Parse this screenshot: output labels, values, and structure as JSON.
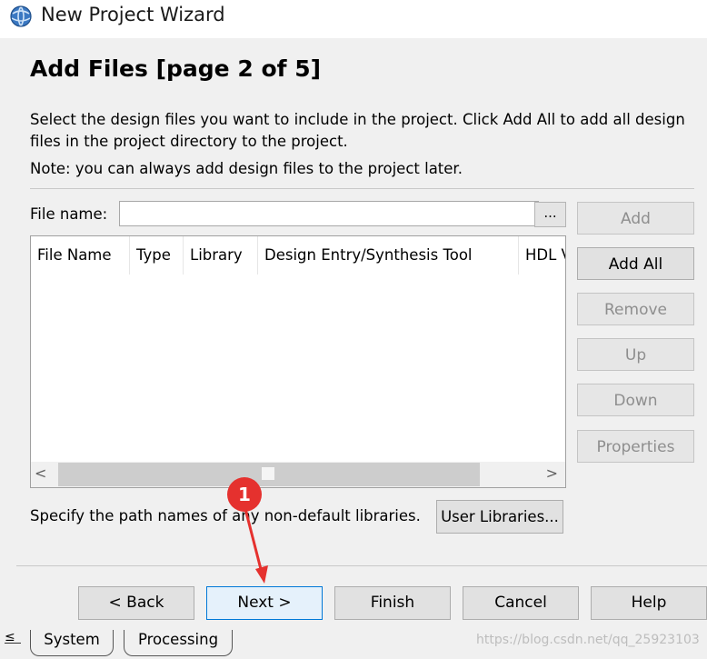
{
  "window": {
    "title": "New Project Wizard",
    "icon": "quartus-globe-icon"
  },
  "page": {
    "title": "Add Files [page 2 of 5]",
    "description": "Select the design files you want to include in the project. Click Add All to add all design files in the project directory to the project.",
    "note": "Note: you can always add design files to the project later."
  },
  "file_name": {
    "label": "File name:",
    "value": "",
    "browse_label": "..."
  },
  "table": {
    "columns": [
      "File Name",
      "Type",
      "Library",
      "Design Entry/Synthesis Tool",
      "HDL Version"
    ],
    "rows": []
  },
  "side_buttons": {
    "add": "Add",
    "add_all": "Add All",
    "remove": "Remove",
    "up": "Up",
    "down": "Down",
    "properties": "Properties"
  },
  "libraries": {
    "text": "Specify the path names of any non-default libraries.",
    "button": "User Libraries..."
  },
  "nav_buttons": {
    "back": "< Back",
    "next": "Next >",
    "finish": "Finish",
    "cancel": "Cancel",
    "help": "Help"
  },
  "annotation": {
    "badge": "1",
    "color": "#e5312e"
  },
  "background_tabs": [
    "System",
    "Processing"
  ],
  "watermark": "https://blog.csdn.net/qq_25923103",
  "colors": {
    "default_button_border": "#0078d7",
    "disabled_text": "#8e8e8e"
  }
}
